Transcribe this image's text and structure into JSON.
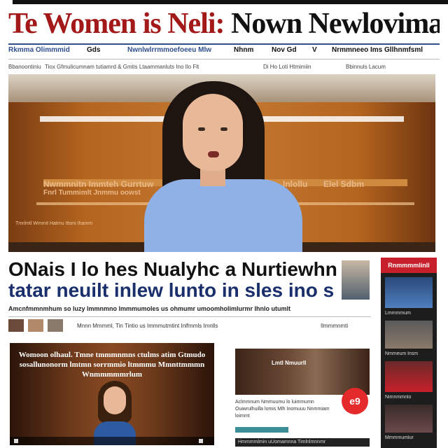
{
  "masthead": {
    "part1": "Te Women is Neli:",
    "part2": " Nown Newlovimarits"
  },
  "nav": {
    "items": [
      "Rkmma Olimmmid",
      "Gds",
      "Nwnlwlrrmmoefoeeu Mlw",
      "Nhnm",
      "Nov Gd",
      "V",
      "Nrmmneeo Ims Gllhnmfsml"
    ]
  },
  "subnav": {
    "items": [
      "Bbanoontiniu",
      "Tiox Gfmulicumnam tutiamrd & Gmtis Ltaammanluts Ino Ilo Flt",
      "Di Ho Loti Htmimiin",
      "Bbinnuls Lacum"
    ]
  },
  "hero": {
    "wall_left": "Nwmmnitn Immteh Gurrtuw",
    "wall_left2": "Fnrl Tummimlt Jnmmu oowst",
    "wall_right": "Inlollu",
    "wall_right2": "Elel Sdbm",
    "caption": "Tmrlmtl Wmmit Hatmu Ittoni Ihamm"
  },
  "headline": {
    "line1": "ONais I lo hes Nualyhc a Nurtiewhn",
    "line2": "tatar neuilt inlew lunto in sles ino s"
  },
  "dek": "Amcnfmmnmhum so luzy lmmnmno lmmmumoles us ohmumr umoomholimlurmr Ihnlo utumlt",
  "byline": {
    "text": "Mnnn Mmmml, Tin Tintio us Immmutmtint Inlfmmls Imnlls",
    "right": "Ilmmmnmti"
  },
  "video": {
    "title": "Womoon olhaul. Tmne tmmmnmns ctulms atim Gtmudo sosallunonorm lmtmn sorrmmio ltmmmu Mmnttmmmn Wnmmmmmrlum"
  },
  "card": {
    "sign": "Lmtl Nmuurll",
    "text": "Aclmmnum Nmmuumu lo luimmumn Ouiwrulhuilla lomis Mlh Inomuuu Nnmmiam loimmt",
    "badge": "e9",
    "bottom": "Hmmmmlmin uUomamnna Timlnlmnnmr"
  },
  "sidebar": {
    "header": "Rnmmmmlinll",
    "captions": [
      "Lmmmmum",
      "Nmmeum lnsm",
      "Nimnmmnlo",
      "Mmmmumlur"
    ]
  },
  "colors": {
    "brand_red": "#a31818",
    "nav_blue": "#2f4f8f",
    "badge_red": "#e42a2a",
    "sidebar_red": "#c8202a"
  }
}
